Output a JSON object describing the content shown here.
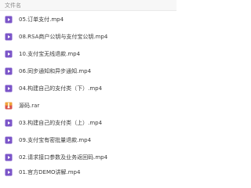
{
  "header": {
    "column_title": "文件名"
  },
  "files": [
    {
      "name": "05.订单支付.mp4",
      "icon": "video-file-icon"
    },
    {
      "name": "08.RSA商户公钥与支付宝公钥.mp4",
      "icon": "video-file-icon"
    },
    {
      "name": "10.支付宝无线退款.mp4",
      "icon": "video-file-icon"
    },
    {
      "name": "06.同步通知和异步通知.mp4",
      "icon": "video-file-icon"
    },
    {
      "name": "04.构建自己的支付类（下）.mp4",
      "icon": "video-file-icon"
    },
    {
      "name": "源码.rar",
      "icon": "archive-file-icon"
    },
    {
      "name": "03.构建自己的支付类（上）.mp4",
      "icon": "video-file-icon"
    },
    {
      "name": "09.支付宝有密批量退款.mp4",
      "icon": "video-file-icon"
    },
    {
      "name": "02.请求接口参数及业务返回码.mp4",
      "icon": "video-file-icon"
    },
    {
      "name": "01.官方DEMO讲解.mp4",
      "icon": "video-file-icon"
    }
  ],
  "colors": {
    "video_icon": "#7b55c8",
    "archive_icon_top": "#f0a33a",
    "archive_icon_bottom": "#d9534f"
  }
}
